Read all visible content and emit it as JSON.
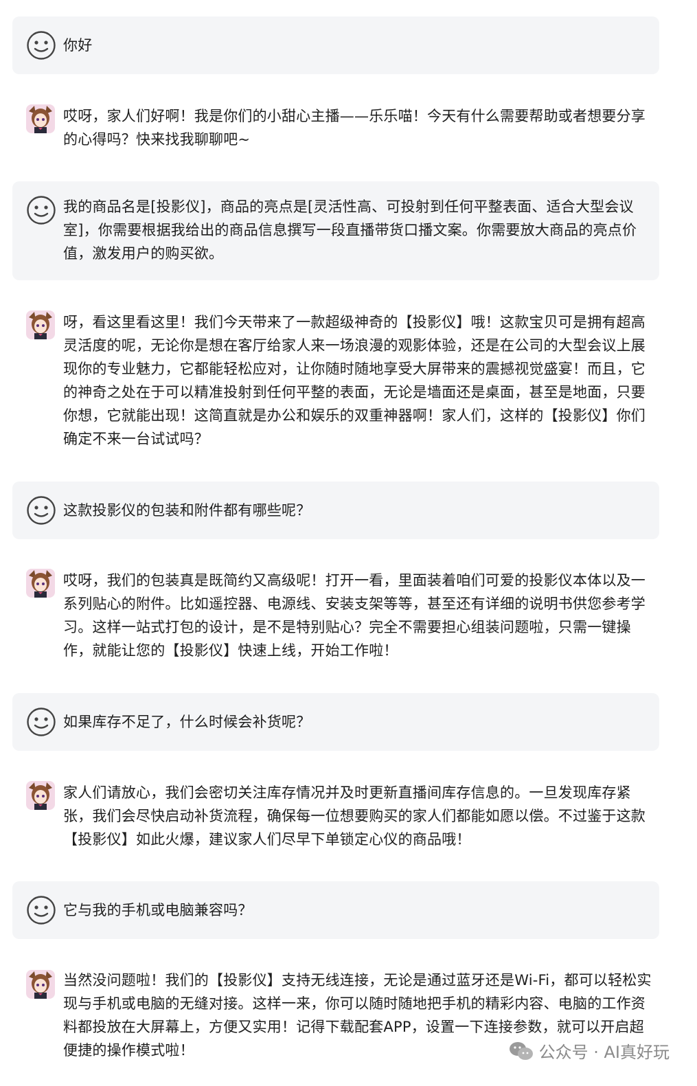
{
  "conversation": {
    "messages": [
      {
        "role": "user",
        "text": "你好"
      },
      {
        "role": "assistant",
        "text": "哎呀，家人们好啊！我是你们的小甜心主播——乐乐喵！今天有什么需要帮助或者想要分享的心得吗？快来找我聊聊吧~"
      },
      {
        "role": "user",
        "text": "我的商品名是[投影仪]，商品的亮点是[灵活性高、可投射到任何平整表面、适合大型会议室]，你需要根据我给出的商品信息撰写一段直播带货口播文案。你需要放大商品的亮点价值，激发用户的购买欲。"
      },
      {
        "role": "assistant",
        "text": "呀，看这里看这里！我们今天带来了一款超级神奇的【投影仪】哦！这款宝贝可是拥有超高灵活度的呢，无论你是想在客厅给家人来一场浪漫的观影体验，还是在公司的大型会议上展现你的专业魅力，它都能轻松应对，让你随时随地享受大屏带来的震撼视觉盛宴！而且，它的神奇之处在于可以精准投射到任何平整的表面，无论是墙面还是桌面，甚至是地面，只要你想，它就能出现！这简直就是办公和娱乐的双重神器啊！家人们，这样的【投影仪】你们确定不来一台试试吗？"
      },
      {
        "role": "user",
        "text": "这款投影仪的包装和附件都有哪些呢？"
      },
      {
        "role": "assistant",
        "text": "哎呀，我们的包装真是既简约又高级呢！打开一看，里面装着咱们可爱的投影仪本体以及一系列贴心的附件。比如遥控器、电源线、安装支架等等，甚至还有详细的说明书供您参考学习。这样一站式打包的设计，是不是特别贴心？完全不需要担心组装问题啦，只需一键操作，就能让您的【投影仪】快速上线，开始工作啦！"
      },
      {
        "role": "user",
        "text": "如果库存不足了，什么时候会补货呢？"
      },
      {
        "role": "assistant",
        "text": "家人们请放心，我们会密切关注库存情况并及时更新直播间库存信息的。一旦发现库存紧张，我们会尽快启动补货流程，确保每一位想要购买的家人们都能如愿以偿。不过鉴于这款【投影仪】如此火爆，建议家人们尽早下单锁定心仪的商品哦！"
      },
      {
        "role": "user",
        "text": "它与我的手机或电脑兼容吗？"
      },
      {
        "role": "assistant",
        "text": "当然没问题啦！我们的【投影仪】支持无线连接，无论是通过蓝牙还是Wi-Fi，都可以轻松实现与手机或电脑的无缝对接。这样一来，你可以随时随地把手机的精彩内容、电脑的工作资料都投放在大屏幕上，方便又实用！记得下载配套APP，设置一下连接参数，就可以开启超便捷的操作模式啦！"
      }
    ]
  },
  "watermark": {
    "text": "公众号 · AI真好玩",
    "icon": "wechat-logo-icon"
  },
  "colors": {
    "user_bubble": "#f4f5f7",
    "text": "#1f1f1f",
    "watermark": "#8a8a8a"
  }
}
